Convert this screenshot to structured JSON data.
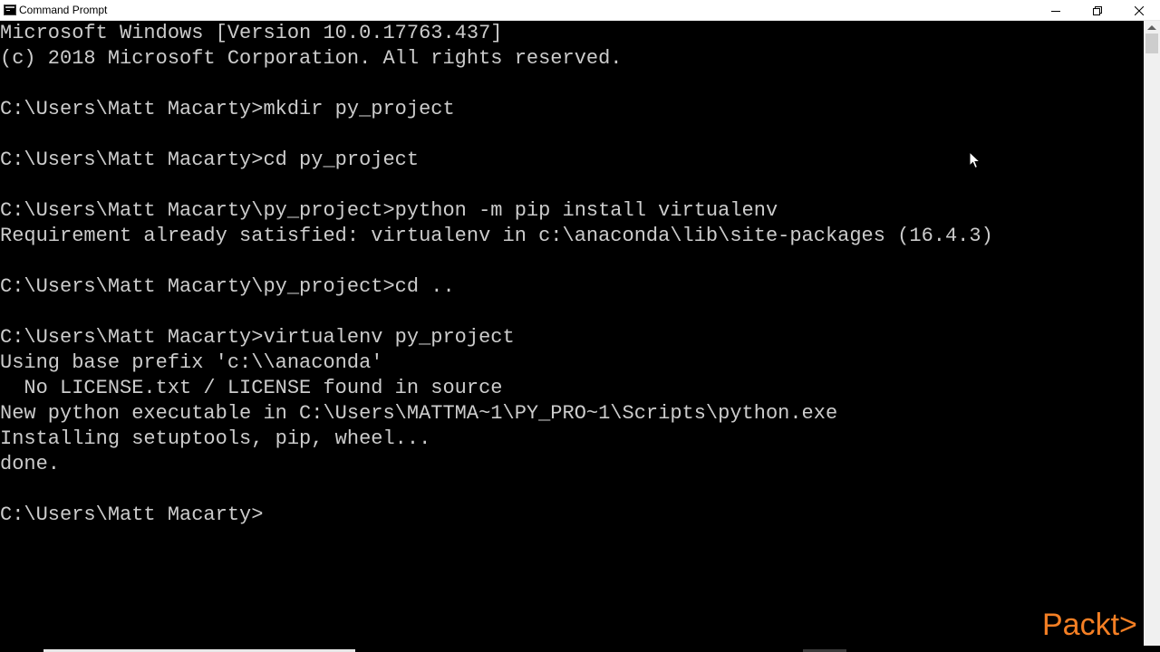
{
  "window": {
    "title": "Command Prompt"
  },
  "console": {
    "lines": [
      "Microsoft Windows [Version 10.0.17763.437]",
      "(c) 2018 Microsoft Corporation. All rights reserved.",
      "",
      "C:\\Users\\Matt Macarty>mkdir py_project",
      "",
      "C:\\Users\\Matt Macarty>cd py_project",
      "",
      "C:\\Users\\Matt Macarty\\py_project>python -m pip install virtualenv",
      "Requirement already satisfied: virtualenv in c:\\anaconda\\lib\\site-packages (16.4.3)",
      "",
      "C:\\Users\\Matt Macarty\\py_project>cd ..",
      "",
      "C:\\Users\\Matt Macarty>virtualenv py_project",
      "Using base prefix 'c:\\\\anaconda'",
      "  No LICENSE.txt / LICENSE found in source",
      "New python executable in C:\\Users\\MATTMA~1\\PY_PRO~1\\Scripts\\python.exe",
      "Installing setuptools, pip, wheel...",
      "done.",
      "",
      "C:\\Users\\Matt Macarty>"
    ]
  },
  "watermark": {
    "text": "Packt>"
  },
  "colors": {
    "console_bg": "#000000",
    "console_text": "#cccccc",
    "titlebar_bg": "#ffffff",
    "watermark": "#f47f24"
  },
  "icons": {
    "app": "cmd-icon",
    "minimize": "minimize-icon",
    "restore": "restore-icon",
    "close": "close-icon"
  }
}
